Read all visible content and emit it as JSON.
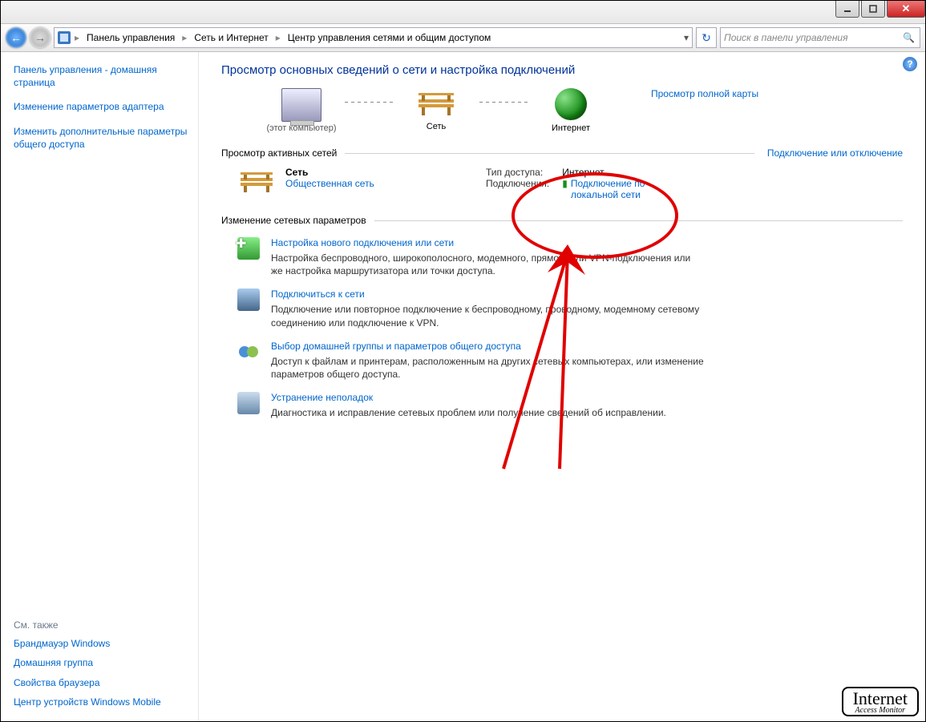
{
  "breadcrumb": {
    "items": [
      "Панель управления",
      "Сеть и Интернет",
      "Центр управления сетями и общим доступом"
    ]
  },
  "search": {
    "placeholder": "Поиск в панели управления"
  },
  "sidebar": {
    "home": "Панель управления - домашняя страница",
    "links": [
      "Изменение параметров адаптера",
      "Изменить дополнительные параметры общего доступа"
    ],
    "see_also_label": "См. также",
    "see_also": [
      "Брандмауэр Windows",
      "Домашняя группа",
      "Свойства браузера",
      "Центр устройств Windows Mobile"
    ]
  },
  "main": {
    "title": "Просмотр основных сведений о сети и настройка подключений",
    "map": {
      "this_pc_caption": "(этот компьютер)",
      "network_caption": "Сеть",
      "internet_caption": "Интернет",
      "full_map": "Просмотр полной карты"
    },
    "active_section": {
      "header": "Просмотр активных сетей",
      "rightlink": "Подключение или отключение",
      "network_name": "Сеть",
      "network_type": "Общественная сеть",
      "access_label": "Тип доступа:",
      "access_value": "Интернет",
      "conn_label": "Подключения:",
      "conn_value": "Подключение по локальной сети"
    },
    "change_section": "Изменение сетевых параметров",
    "tasks": [
      {
        "title": "Настройка нового подключения или сети",
        "desc": "Настройка беспроводного, широкополосного, модемного, прямого или VPN-подключения или же настройка маршрутизатора или точки доступа."
      },
      {
        "title": "Подключиться к сети",
        "desc": "Подключение или повторное подключение к беспроводному, проводному, модемному сетевому соединению или подключение к VPN."
      },
      {
        "title": "Выбор домашней группы и параметров общего доступа",
        "desc": "Доступ к файлам и принтерам, расположенным на других сетевых компьютерах, или изменение параметров общего доступа."
      },
      {
        "title": "Устранение неполадок",
        "desc": "Диагностика и исправление сетевых проблем или получение сведений об исправлении."
      }
    ]
  },
  "watermark": {
    "title": "Internet",
    "sub": "Access Monitor"
  }
}
